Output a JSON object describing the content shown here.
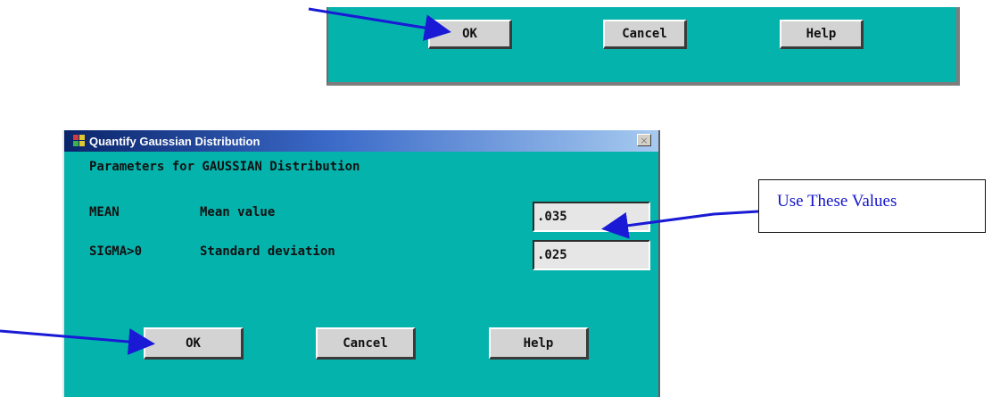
{
  "top_strip": {
    "ok_label": "OK",
    "cancel_label": "Cancel",
    "help_label": "Help"
  },
  "dialog": {
    "title": "Quantify Gaussian Distribution",
    "close_glyph": "×",
    "heading": "Parameters for GAUSSIAN Distribution",
    "params": [
      {
        "key": "MEAN",
        "description": "Mean value",
        "value": ".035"
      },
      {
        "key": "SIGMA>0",
        "description": "Standard deviation",
        "value": ".025"
      }
    ],
    "ok_label": "OK",
    "cancel_label": "Cancel",
    "help_label": "Help"
  },
  "callout": {
    "text": "Use These Values"
  },
  "colors": {
    "dialog_bg": "#05b3ad",
    "title_bar_start": "#0a246a",
    "title_bar_end": "#a6caf0",
    "arrow": "#1a1ad6",
    "callout_text": "#1414cc"
  },
  "icons": {
    "app": "colored-squares-app-icon",
    "close": "close-icon"
  }
}
